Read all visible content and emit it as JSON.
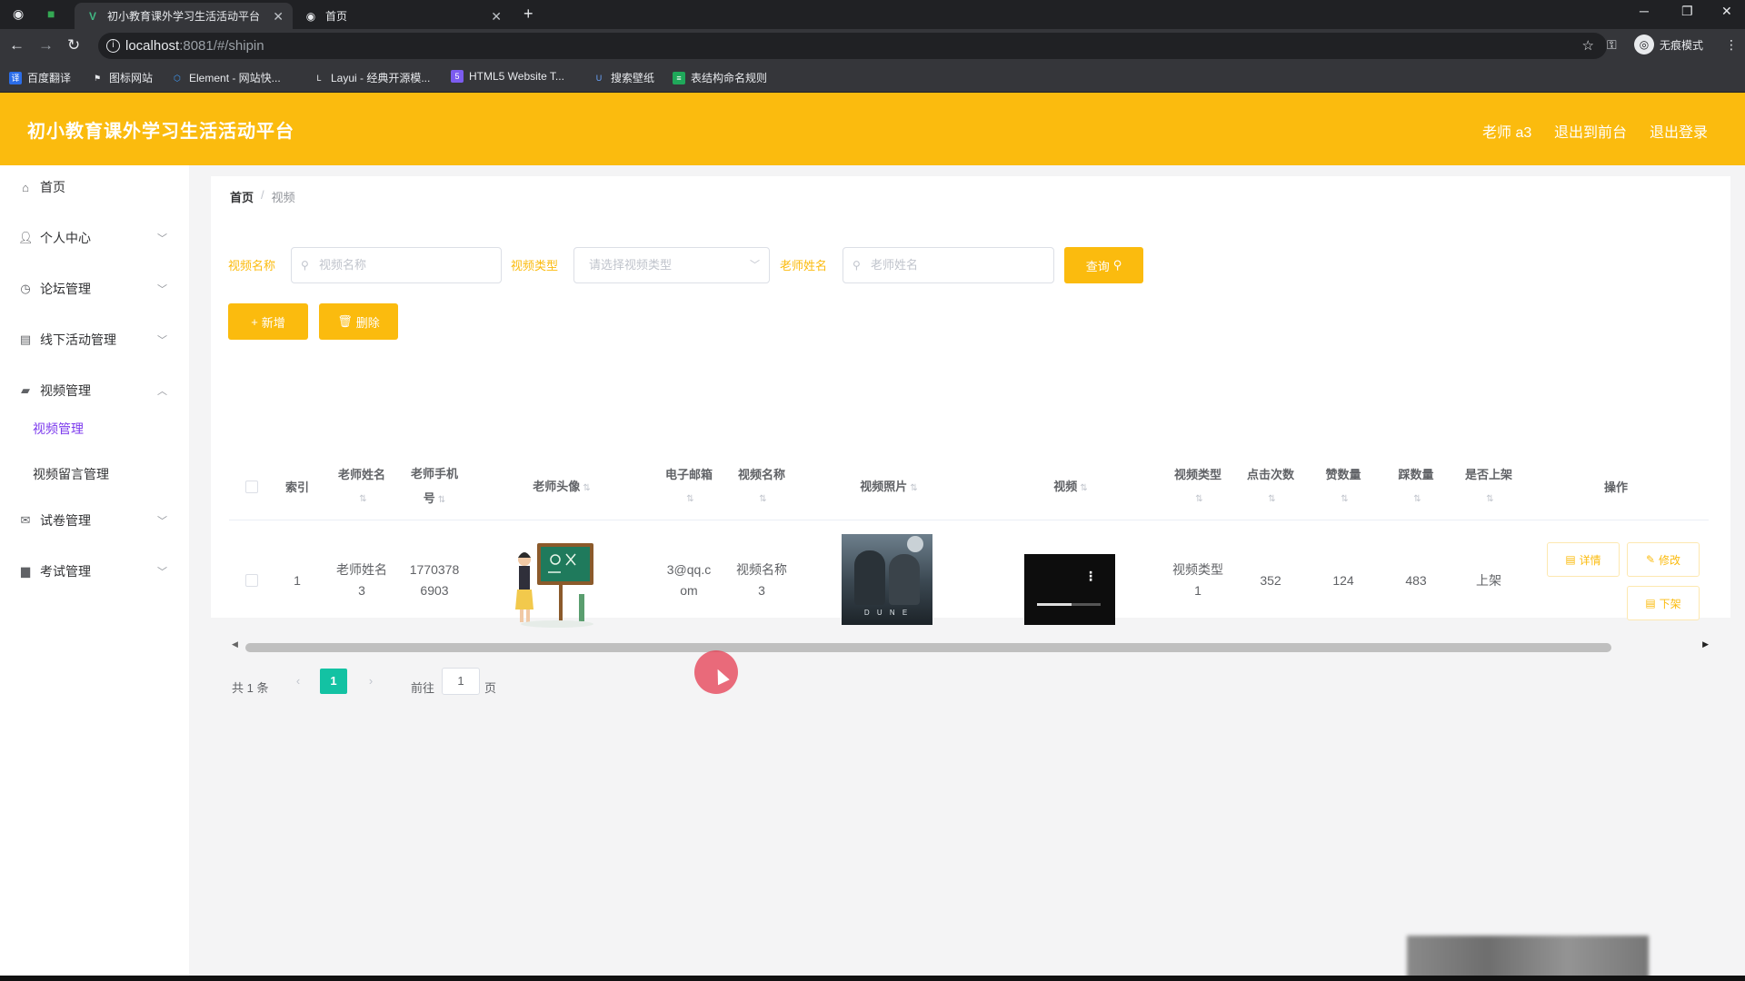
{
  "browser": {
    "tabs": [
      {
        "title": "初小教育课外学习生活活动平台",
        "active": true
      },
      {
        "title": "首页",
        "active": false
      }
    ],
    "new_tab": "+",
    "url_host": "localhost",
    "url_path": ":8081/#/shipin",
    "incognito_label": "无痕模式",
    "bookmarks": [
      "百度翻译",
      "图标网站",
      "Element - 网站快...",
      "Layui - 经典开源模...",
      "HTML5 Website T...",
      "搜索壁纸",
      "表结构命名规则"
    ]
  },
  "header": {
    "title": "初小教育课外学习生活活动平台",
    "user": "老师 a3",
    "front_link": "退出到前台",
    "logout_link": "退出登录"
  },
  "sidebar": {
    "items": [
      {
        "label": "首页",
        "icon": "home-icon"
      },
      {
        "label": "个人中心",
        "icon": "user-icon"
      },
      {
        "label": "论坛管理",
        "icon": "clock-icon"
      },
      {
        "label": "线下活动管理",
        "icon": "document-icon"
      },
      {
        "label": "视频管理",
        "icon": "video-icon"
      },
      {
        "label": "试卷管理",
        "icon": "mail-icon"
      },
      {
        "label": "考试管理",
        "icon": "briefcase-icon"
      }
    ],
    "sub_items": [
      {
        "label": "视频管理",
        "active": true
      },
      {
        "label": "视频留言管理",
        "active": false
      }
    ]
  },
  "breadcrumb": {
    "home": "首页",
    "separator": "/",
    "current": "视频"
  },
  "filters": {
    "video_name_label": "视频名称",
    "video_name_placeholder": "视频名称",
    "video_type_label": "视频类型",
    "video_type_placeholder": "请选择视频类型",
    "teacher_name_label": "老师姓名",
    "teacher_name_placeholder": "老师姓名",
    "query_button": "查询"
  },
  "actions": {
    "add": "新增",
    "delete": "删除"
  },
  "table": {
    "headers": {
      "index": "索引",
      "teacher_name_1": "老师姓名",
      "teacher_phone_1": "老师手机",
      "teacher_phone_2": "号",
      "teacher_avatar": "老师头像",
      "email": "电子邮箱",
      "video_name": "视频名称",
      "video_photo": "视频照片",
      "video": "视频",
      "video_type": "视频类型",
      "clicks": "点击次数",
      "likes": "赞数量",
      "dislikes": "踩数量",
      "on_shelf": "是否上架",
      "operation": "操作"
    },
    "rows": [
      {
        "index": "1",
        "teacher_name_1": "老师姓名",
        "teacher_name_2": "3",
        "phone_1": "1770378",
        "phone_2": "6903",
        "email_1": "3@qq.c",
        "email_2": "om",
        "video_name_1": "视频名称",
        "video_name_2": "3",
        "video_type_1": "视频类型",
        "video_type_2": "1",
        "clicks": "352",
        "likes": "124",
        "dislikes": "483",
        "on_shelf": "上架",
        "poster_text": "D U N E",
        "btn_detail": "详情",
        "btn_edit": "修改",
        "btn_off": "下架"
      }
    ]
  },
  "pagination": {
    "total": "共 1 条",
    "prev": "‹",
    "page": "1",
    "next": "›",
    "goto": "前往",
    "goto_value": "1",
    "page_suffix": "页"
  },
  "colors": {
    "accent": "#fbbb0e",
    "pager_active": "#13c2a3",
    "submenu_active": "#7c3aed"
  }
}
